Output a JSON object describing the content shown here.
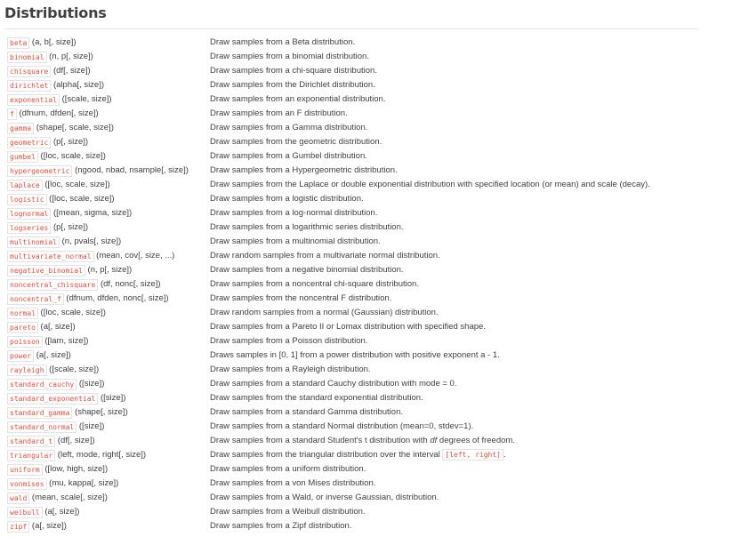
{
  "title": "Distributions",
  "rows": [
    {
      "name": "beta",
      "sig": "(a, b[, size])",
      "desc": "Draw samples from a Beta distribution."
    },
    {
      "name": "binomial",
      "sig": "(n, p[, size])",
      "desc": "Draw samples from a binomial distribution."
    },
    {
      "name": "chisquare",
      "sig": "(df[, size])",
      "desc": "Draw samples from a chi-square distribution."
    },
    {
      "name": "dirichlet",
      "sig": "(alpha[, size])",
      "desc": "Draw samples from the Dirichlet distribution."
    },
    {
      "name": "exponential",
      "sig": "([scale, size])",
      "desc": "Draw samples from an exponential distribution."
    },
    {
      "name": "f",
      "sig": "(dfnum, dfden[, size])",
      "desc": "Draw samples from an F distribution."
    },
    {
      "name": "gamma",
      "sig": "(shape[, scale, size])",
      "desc": "Draw samples from a Gamma distribution."
    },
    {
      "name": "geometric",
      "sig": "(p[, size])",
      "desc": "Draw samples from the geometric distribution."
    },
    {
      "name": "gumbel",
      "sig": "([loc, scale, size])",
      "desc": "Draw samples from a Gumbel distribution."
    },
    {
      "name": "hypergeometric",
      "sig": "(ngood, nbad, nsample[, size])",
      "desc": "Draw samples from a Hypergeometric distribution."
    },
    {
      "name": "laplace",
      "sig": "([loc, scale, size])",
      "desc": "Draw samples from the Laplace or double exponential distribution with specified location (or mean) and scale (decay)."
    },
    {
      "name": "logistic",
      "sig": "([loc, scale, size])",
      "desc": "Draw samples from a logistic distribution."
    },
    {
      "name": "lognormal",
      "sig": "([mean, sigma, size])",
      "desc": "Draw samples from a log-normal distribution."
    },
    {
      "name": "logseries",
      "sig": "(p[, size])",
      "desc": "Draw samples from a logarithmic series distribution."
    },
    {
      "name": "multinomial",
      "sig": "(n, pvals[, size])",
      "desc": "Draw samples from a multinomial distribution."
    },
    {
      "name": "multivariate_normal",
      "sig": "(mean, cov[, size, ...)",
      "desc": "Draw random samples from a multivariate normal distribution."
    },
    {
      "name": "negative_binomial",
      "sig": "(n, p[, size])",
      "desc": "Draw samples from a negative binomial distribution."
    },
    {
      "name": "noncentral_chisquare",
      "sig": "(df, nonc[, size])",
      "desc": "Draw samples from a noncentral chi-square distribution."
    },
    {
      "name": "noncentral_f",
      "sig": "(dfnum, dfden, nonc[, size])",
      "desc": "Draw samples from the noncentral F distribution."
    },
    {
      "name": "normal",
      "sig": "([loc, scale, size])",
      "desc": "Draw random samples from a normal (Gaussian) distribution."
    },
    {
      "name": "pareto",
      "sig": "(a[, size])",
      "desc": "Draw samples from a Pareto II or Lomax distribution with specified shape."
    },
    {
      "name": "poisson",
      "sig": "([lam, size])",
      "desc": "Draw samples from a Poisson distribution."
    },
    {
      "name": "power",
      "sig": "(a[, size])",
      "desc": "Draws samples in [0, 1] from a power distribution with positive exponent a - 1."
    },
    {
      "name": "rayleigh",
      "sig": "([scale, size])",
      "desc": "Draw samples from a Rayleigh distribution."
    },
    {
      "name": "standard_cauchy",
      "sig": "([size])",
      "desc": "Draw samples from a standard Cauchy distribution with mode = 0."
    },
    {
      "name": "standard_exponential",
      "sig": "([size])",
      "desc": "Draw samples from the standard exponential distribution."
    },
    {
      "name": "standard_gamma",
      "sig": "(shape[, size])",
      "desc": "Draw samples from a standard Gamma distribution."
    },
    {
      "name": "standard_normal",
      "sig": "([size])",
      "desc": "Draw samples from a standard Normal distribution (mean=0, stdev=1)."
    },
    {
      "name": "standard_t",
      "sig": "(df[, size])",
      "desc_pre": "Draw samples from a standard Student's t distribution with ",
      "desc_em": "df",
      "desc_post": " degrees of freedom."
    },
    {
      "name": "triangular",
      "sig": "(left, mode, right[, size])",
      "desc_pre": "Draw samples from the triangular distribution over the interval ",
      "desc_code": "[left, right]",
      "desc_post": "."
    },
    {
      "name": "uniform",
      "sig": "([low, high, size])",
      "desc": "Draw samples from a uniform distribution."
    },
    {
      "name": "vonmises",
      "sig": "(mu, kappa[, size])",
      "desc": "Draw samples from a von Mises distribution."
    },
    {
      "name": "wald",
      "sig": "(mean, scale[, size])",
      "desc": "Draw samples from a Wald, or inverse Gaussian, distribution."
    },
    {
      "name": "weibull",
      "sig": "(a[, size])",
      "desc": "Draw samples from a Weibull distribution."
    },
    {
      "name": "zipf",
      "sig": "(a[, size])",
      "desc": "Draw samples from a Zipf distribution."
    }
  ]
}
